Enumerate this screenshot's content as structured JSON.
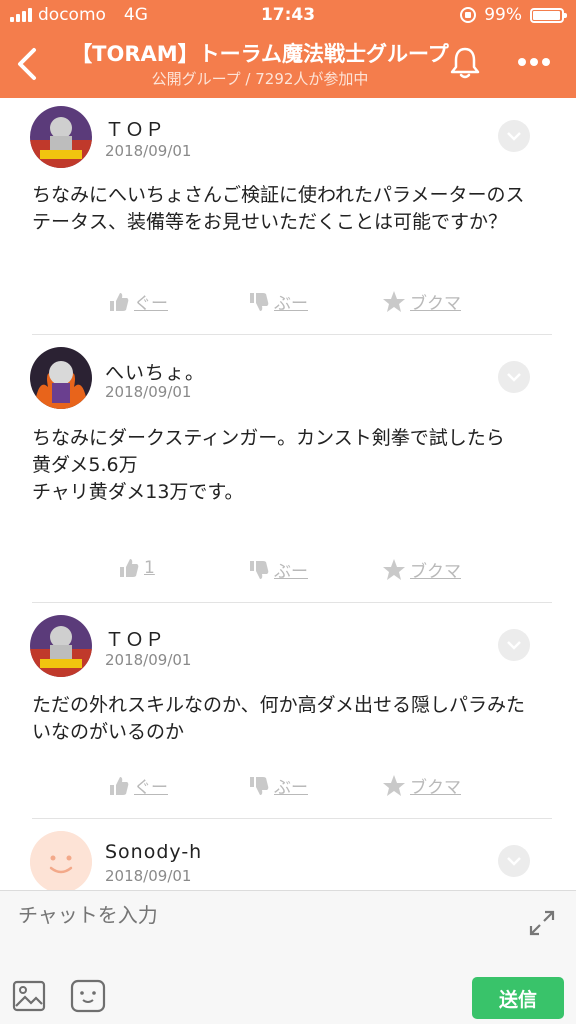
{
  "status_bar": {
    "carrier": "docomo",
    "network": "4G",
    "time": "17:43",
    "battery": "99%"
  },
  "header": {
    "title": "【TORAM】トーラム魔法戦士グループ",
    "subtitle": "公開グループ / 7292人が参加中"
  },
  "messages": [
    {
      "name": "ＴＯＰ",
      "date": "2018/09/01",
      "text": "ちなみにへいちょさんご検証に使われたパラメーターのステータス、装備等をお見せいただくことは可能ですか？",
      "like": "ぐー",
      "dislike": "ぶー",
      "bookmark": "ブクマ"
    },
    {
      "name": "へいちょ。",
      "date": "2018/09/01",
      "text": "ちなみにダークスティンガー。カンスト剣拳で試したら\n黄ダメ5.6万\nチャリ黄ダメ13万です。",
      "like": "1",
      "dislike": "ぶー",
      "bookmark": "ブクマ"
    },
    {
      "name": "ＴＯＰ",
      "date": "2018/09/01",
      "text": "ただの外れスキルなのか、何か高ダメ出せる隠しパラみたいなのがいるのか",
      "like": "ぐー",
      "dislike": "ぶー",
      "bookmark": "ブクマ"
    },
    {
      "name": "Sonody-h",
      "date": "2018/09/01"
    }
  ],
  "input": {
    "placeholder": "チャットを入力",
    "send_label": "送信"
  },
  "colors": {
    "brand": "#f47d4c",
    "send": "#39c36a"
  }
}
